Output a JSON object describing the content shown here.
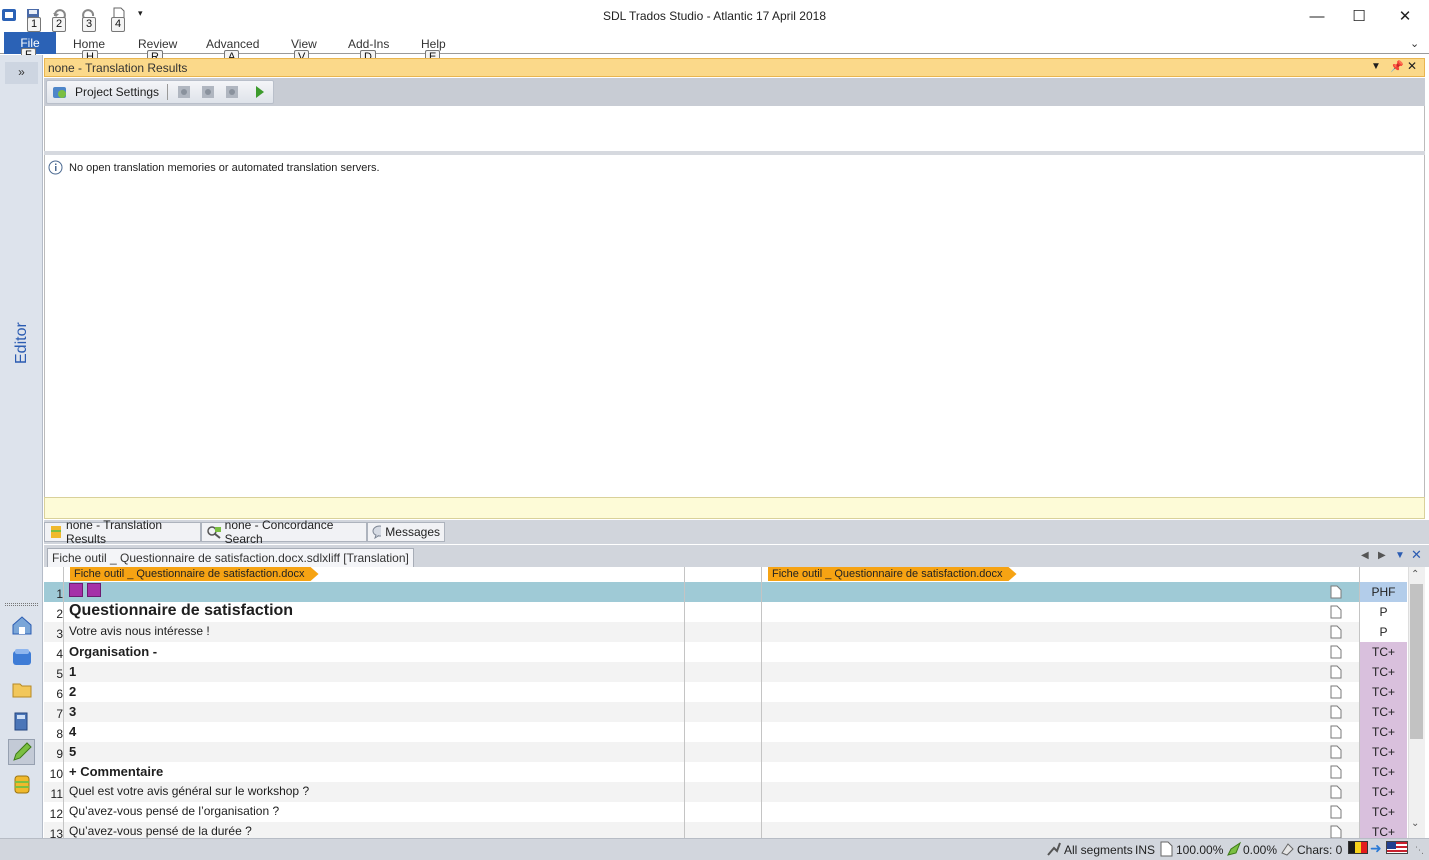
{
  "window": {
    "title": "SDL Trados Studio - Atlantic 17 April 2018"
  },
  "quick_access": {
    "keytips": [
      "1",
      "2",
      "3",
      "4"
    ]
  },
  "ribbon": {
    "file_label": "File",
    "file_keytip": "F",
    "tabs": [
      {
        "label": "Home",
        "keytip": "H"
      },
      {
        "label": "Review",
        "keytip": "R"
      },
      {
        "label": "Advanced",
        "keytip": "A"
      },
      {
        "label": "View",
        "keytip": "V"
      },
      {
        "label": "Add-Ins",
        "keytip": "D"
      },
      {
        "label": "Help",
        "keytip": "E"
      }
    ]
  },
  "sidebar": {
    "collapse_glyph": "»",
    "label": "Editor"
  },
  "translation_results": {
    "header": "none - Translation Results",
    "project_settings": "Project Settings",
    "message": "No open translation memories or automated translation servers."
  },
  "panel_tabs": [
    "none - Translation Results",
    "none - Concordance Search",
    "Messages"
  ],
  "document_tab": "Fiche outil _ Questionnaire de satisfaction.docx.sdlxliff [Translation]",
  "file_tag": "Fiche outil _ Questionnaire de satisfaction.docx",
  "segments": [
    {
      "num": "1",
      "source": "",
      "style": "tags",
      "mark": "PHF"
    },
    {
      "num": "2",
      "source": "Questionnaire de satisfaction",
      "style": "big",
      "mark": "P"
    },
    {
      "num": "3",
      "source": "Votre avis nous intéresse !",
      "style": "normal",
      "mark": "P"
    },
    {
      "num": "4",
      "source": "Organisation            -",
      "style": "bold",
      "mark": "TC+"
    },
    {
      "num": "5",
      "source": "1",
      "style": "bold",
      "mark": "TC+"
    },
    {
      "num": "6",
      "source": "2",
      "style": "bold",
      "mark": "TC+"
    },
    {
      "num": "7",
      "source": "3",
      "style": "bold",
      "mark": "TC+"
    },
    {
      "num": "8",
      "source": "4",
      "style": "bold",
      "mark": "TC+"
    },
    {
      "num": "9",
      "source": "5",
      "style": "bold",
      "mark": "TC+"
    },
    {
      "num": "10",
      "source": "+                  Commentaire",
      "style": "bold",
      "mark": "TC+"
    },
    {
      "num": "11",
      "source": "Quel est votre avis général sur le workshop ?",
      "style": "normal",
      "mark": "TC+"
    },
    {
      "num": "12",
      "source": "Qu’avez-vous pensé de l’organisation ?",
      "style": "normal",
      "mark": "TC+"
    },
    {
      "num": "13",
      "source": "Qu’avez-vous pensé de la durée ?",
      "style": "normal",
      "mark": "TC+"
    }
  ],
  "status_bar": {
    "filter": "All segments",
    "mode": "INS",
    "percent1": "100.00%",
    "percent2": "0.00%",
    "chars": "Chars: 0"
  }
}
